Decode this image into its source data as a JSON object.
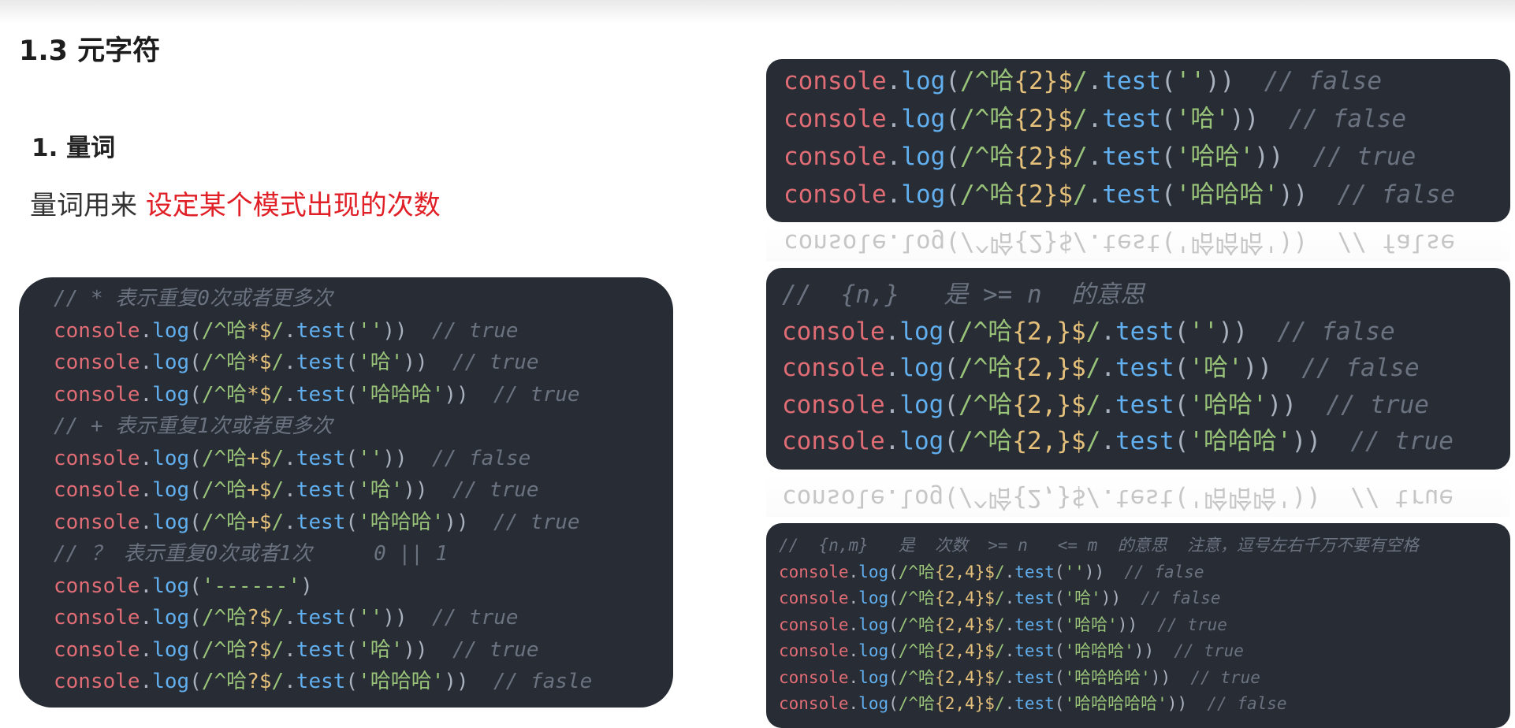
{
  "heading": "1.3 元字符",
  "subheading": "1.  量词",
  "description": {
    "prefix": "量词用来",
    "highlight": "设定某个模式出现的次数"
  },
  "code_left": [
    {
      "comment": "// * 表示重复0次或者更多次"
    },
    {
      "re": "/^哈*$/",
      "arg": "''",
      "comment": "// true"
    },
    {
      "re": "/^哈*$/",
      "arg": "'哈'",
      "comment": "// true"
    },
    {
      "re": "/^哈*$/",
      "arg": "'哈哈哈'",
      "comment": "// true"
    },
    {
      "comment": "// + 表示重复1次或者更多次"
    },
    {
      "re": "/^哈+$/",
      "arg": "''",
      "comment": "// false"
    },
    {
      "re": "/^哈+$/",
      "arg": "'哈'",
      "comment": "// true"
    },
    {
      "re": "/^哈+$/",
      "arg": "'哈哈哈'",
      "comment": "// true"
    },
    {
      "comment": "// ？ 表示重复0次或者1次     0 || 1"
    },
    {
      "plain": "'------'"
    },
    {
      "re": "/^哈?$/",
      "arg": "''",
      "comment": "// true"
    },
    {
      "re": "/^哈?$/",
      "arg": "'哈'",
      "comment": "// true"
    },
    {
      "re": "/^哈?$/",
      "arg": "'哈哈哈'",
      "comment": "// fasle"
    }
  ],
  "code_top_right": [
    {
      "re": "/^哈{2}$/",
      "arg": "''",
      "comment": "// false"
    },
    {
      "re": "/^哈{2}$/",
      "arg": "'哈'",
      "comment": "// false"
    },
    {
      "re": "/^哈{2}$/",
      "arg": "'哈哈'",
      "comment": "// true"
    },
    {
      "re": "/^哈{2}$/",
      "arg": "'哈哈哈'",
      "comment": "// false"
    }
  ],
  "code_mid_right": [
    {
      "comment": "//  {n,}   是 >= n  的意思"
    },
    {
      "re": "/^哈{2,}$/",
      "arg": "''",
      "comment": "// false"
    },
    {
      "re": "/^哈{2,}$/",
      "arg": "'哈'",
      "comment": "// false"
    },
    {
      "re": "/^哈{2,}$/",
      "arg": "'哈哈'",
      "comment": "// true"
    },
    {
      "re": "/^哈{2,}$/",
      "arg": "'哈哈哈'",
      "comment": "// true"
    }
  ],
  "code_bottom_right": [
    {
      "comment": "//  {n,m}   是  次数  >= n   <= m  的意思  注意，逗号左右千万不要有空格"
    },
    {
      "re": "/^哈{2,4}$/",
      "arg": "''",
      "comment": "// false"
    },
    {
      "re": "/^哈{2,4}$/",
      "arg": "'哈'",
      "comment": "// false"
    },
    {
      "re": "/^哈{2,4}$/",
      "arg": "'哈哈'",
      "comment": "// true"
    },
    {
      "re": "/^哈{2,4}$/",
      "arg": "'哈哈哈'",
      "comment": "// true"
    },
    {
      "re": "/^哈{2,4}$/",
      "arg": "'哈哈哈哈'",
      "comment": "// true"
    },
    {
      "re": "/^哈{2,4}$/",
      "arg": "'哈哈哈哈哈'",
      "comment": "// false"
    }
  ],
  "reflection_top": {
    "re": "/^哈{2}$/",
    "arg": "'哈哈哈'",
    "comment": "// false"
  },
  "reflection_mid": {
    "re": "/^哈{2,}$/",
    "arg": "'哈哈哈'",
    "comment": "// true"
  },
  "code_tokens": {
    "console": "console",
    "log": "log",
    "test": "test"
  },
  "colors": {
    "code_bg": "#282c34",
    "keyword": "#e06c75",
    "function": "#61afef",
    "regex": "#98c379",
    "quantifier": "#e5c07b",
    "comment": "#6b7280",
    "highlight": "#e01f26"
  }
}
